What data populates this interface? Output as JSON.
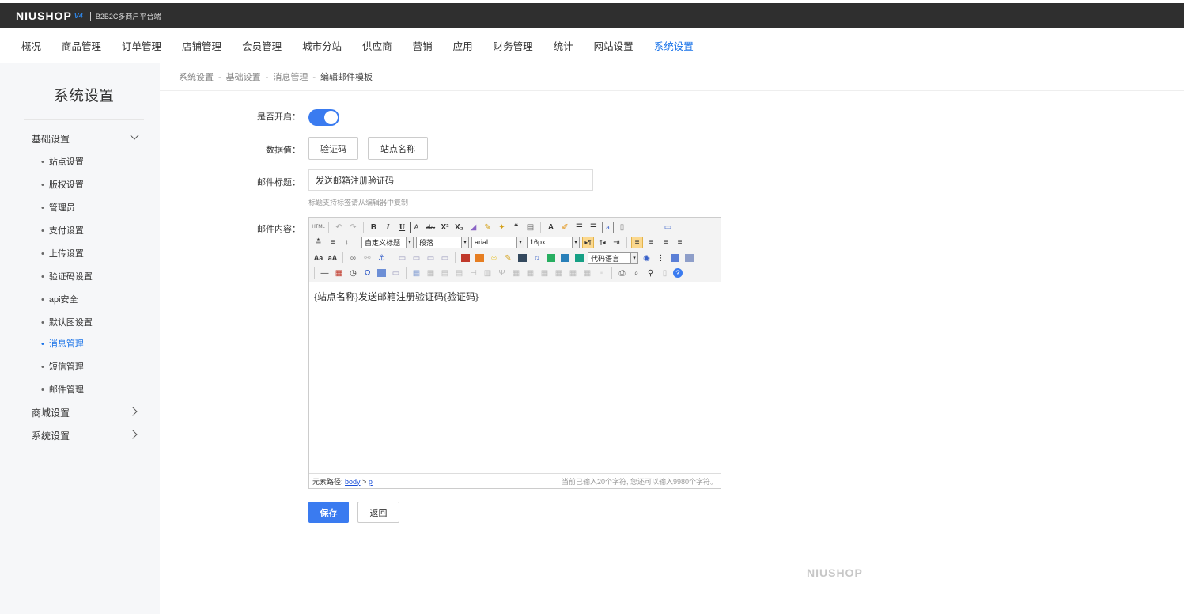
{
  "topbar": {
    "logo": "NIUSHOP",
    "logo_version": "V4",
    "subtitle": "B2B2C多商户平台端"
  },
  "nav": {
    "items": [
      {
        "label": "概况"
      },
      {
        "label": "商品管理"
      },
      {
        "label": "订单管理"
      },
      {
        "label": "店铺管理"
      },
      {
        "label": "会员管理"
      },
      {
        "label": "城市分站"
      },
      {
        "label": "供应商"
      },
      {
        "label": "营销"
      },
      {
        "label": "应用"
      },
      {
        "label": "财务管理"
      },
      {
        "label": "统计"
      },
      {
        "label": "网站设置"
      },
      {
        "label": "系统设置"
      }
    ],
    "active": "系统设置"
  },
  "sidebar": {
    "title": "系统设置",
    "groups": [
      {
        "label": "基础设置",
        "expanded": true
      },
      {
        "label": "商城设置",
        "expanded": false
      },
      {
        "label": "系统设置",
        "expanded": false
      }
    ],
    "sub_items": [
      {
        "label": "站点设置"
      },
      {
        "label": "版权设置"
      },
      {
        "label": "管理员"
      },
      {
        "label": "支付设置"
      },
      {
        "label": "上传设置"
      },
      {
        "label": "验证码设置"
      },
      {
        "label": "api安全"
      },
      {
        "label": "默认图设置"
      },
      {
        "label": "消息管理"
      },
      {
        "label": "短信管理"
      },
      {
        "label": "邮件管理"
      }
    ],
    "active_sub": "消息管理"
  },
  "breadcrumb": {
    "items": [
      "系统设置",
      "基础设置",
      "消息管理"
    ],
    "current": "编辑邮件模板",
    "separator": "-"
  },
  "form": {
    "enabled_label": "是否开启：",
    "enabled": true,
    "data_label": "数据值：",
    "data_buttons": [
      "验证码",
      "站点名称"
    ],
    "subject_label": "邮件标题：",
    "subject_value": "发送邮箱注册验证码",
    "subject_hint": "标题支持标签请从编辑器中复制",
    "content_label": "邮件内容："
  },
  "editor": {
    "combos": {
      "heading": "自定义标题",
      "paragraph": "段落",
      "font": "arial",
      "size": "16px",
      "code": "代码语言"
    },
    "content": "{站点名称}发送邮箱注册验证码{验证码}",
    "path_label": "元素路径:",
    "path_items": [
      "body",
      "p"
    ],
    "path_sep": ">",
    "char_count": "当前已输入20个字符, 您还可以输入9980个字符。"
  },
  "actions": {
    "save": "保存",
    "back": "返回"
  },
  "footer": {
    "logo": "NIUSHOP"
  },
  "colors": {
    "accent": "#3a7bf0",
    "topbar": "#2f2f2f",
    "sidebar_bg": "#f6f7f9",
    "active_text": "#1a73e8"
  }
}
